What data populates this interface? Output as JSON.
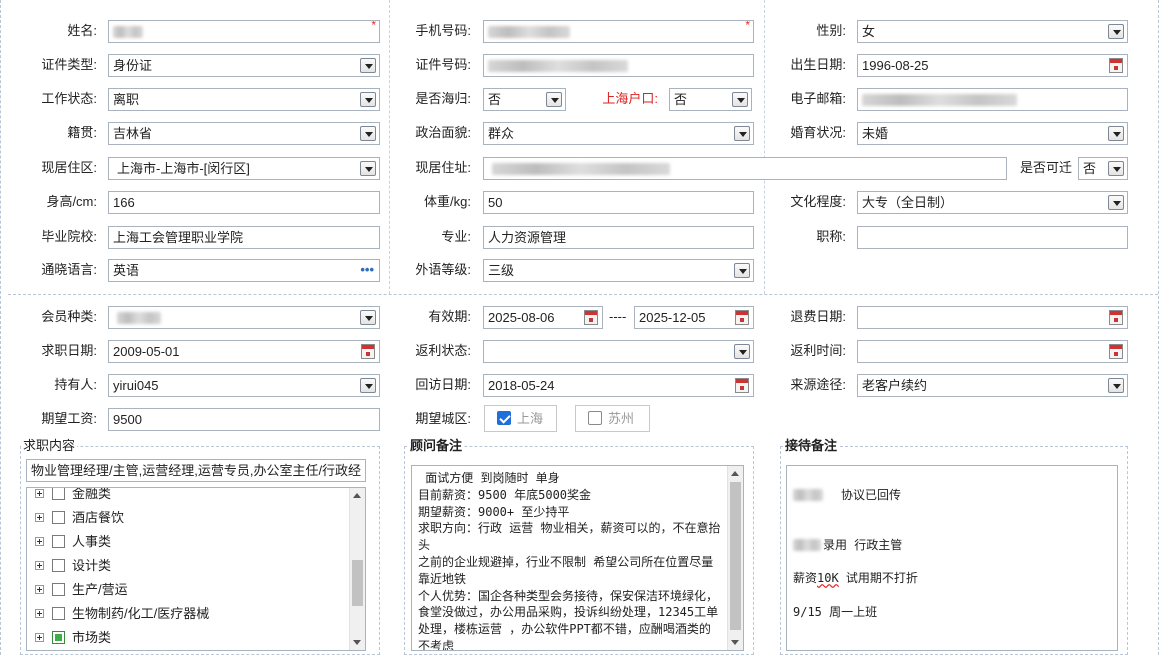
{
  "personal": {
    "name": {
      "label": "姓名:"
    },
    "phone": {
      "label": "手机号码:"
    },
    "gender": {
      "label": "性别:",
      "value": "女"
    },
    "id_type": {
      "label": "证件类型:",
      "value": "身份证"
    },
    "id_no": {
      "label": "证件号码:"
    },
    "birth": {
      "label": "出生日期:",
      "value": "1996-08-25"
    },
    "work_status": {
      "label": "工作状态:",
      "value": "离职"
    },
    "returnee": {
      "label": "是否海归:",
      "value": "否"
    },
    "sh_hukou": {
      "label": "上海户口:",
      "value": "否"
    },
    "email": {
      "label": "电子邮箱:"
    },
    "native": {
      "label": "籍贯:",
      "value": "吉林省"
    },
    "political": {
      "label": "政治面貌:",
      "value": "群众"
    },
    "marital": {
      "label": "婚育状况:",
      "value": "未婚"
    },
    "district": {
      "label": "现居住区:",
      "value": "上海市-上海市-[闵行区]"
    },
    "address": {
      "label": "现居住址:"
    },
    "relocate": {
      "label": "是否可迁",
      "value": "否"
    },
    "height": {
      "label": "身高/cm:",
      "value": "166"
    },
    "weight": {
      "label": "体重/kg:",
      "value": "50"
    },
    "education": {
      "label": "文化程度:",
      "value": "大专（全日制）"
    },
    "school": {
      "label": "毕业院校:",
      "value": "上海工会管理职业学院"
    },
    "major": {
      "label": "专业:",
      "value": "人力资源管理"
    },
    "title": {
      "label": "职称:",
      "value": ""
    },
    "language": {
      "label": "通晓语言:",
      "value": "英语",
      "more": "•••"
    },
    "lang_level": {
      "label": "外语等级:",
      "value": "三级"
    }
  },
  "membership": {
    "member_type": {
      "label": "会员种类:"
    },
    "valid": {
      "label": "有效期:",
      "from": "2025-08-06",
      "sep": "----",
      "to": "2025-12-05"
    },
    "refund_date": {
      "label": "退费日期:",
      "value": ""
    },
    "job_date": {
      "label": "求职日期:",
      "value": "2009-05-01"
    },
    "rebate_status": {
      "label": "返利状态:",
      "value": ""
    },
    "rebate_time": {
      "label": "返利时间:",
      "value": ""
    },
    "holder": {
      "label": "持有人:",
      "value": "yirui045"
    },
    "visit_date": {
      "label": "回访日期:",
      "value": "2018-05-24"
    },
    "source": {
      "label": "来源途径:",
      "value": "老客户续约"
    },
    "salary": {
      "label": "期望工资:",
      "value": "9500"
    },
    "city": {
      "label": "期望城区:",
      "options": [
        {
          "label": "上海",
          "checked": true
        },
        {
          "label": "苏州",
          "checked": false
        }
      ]
    }
  },
  "job_panel": {
    "title": "求职内容",
    "summary": "物业管理经理/主管,运营经理,运营专员,办公室主任/行政经",
    "tree": [
      {
        "label": "金融类",
        "checked": false
      },
      {
        "label": "酒店餐饮",
        "checked": false
      },
      {
        "label": "人事类",
        "checked": false
      },
      {
        "label": "设计类",
        "checked": false
      },
      {
        "label": "生产/营运",
        "checked": false
      },
      {
        "label": "生物制药/化工/医疗器械",
        "checked": false
      },
      {
        "label": "市场类",
        "checked": true
      }
    ]
  },
  "consultant_panel": {
    "title": "顾问备注",
    "lines": [
      " 面试方便 到岗随时 单身",
      "目前薪资：9500 年底5000奖金",
      "期望薪资：9000+ 至少持平",
      "求职方向：行政 运营 物业相关，薪资可以的，不在意抬头",
      "之前的企业规避掉，行业不限制 希望公司所在位置尽量靠近地铁",
      "个人优势：国企各种类型会务接待，保安保洁环境绿化，食堂没做过，办公用品采购，投诉纠纷处理，12345工单处理，楼栋运营 ，办公软件PPT都不错，应酬喝酒类的不考虑"
    ]
  },
  "reception_panel": {
    "title": "接待备注",
    "line1": "协议已回传",
    "line2": "录用 行政主管",
    "line3a": "薪资",
    "line3b": "10K",
    "line3c": " 试用期不打折",
    "line4": "9/15 周一上班"
  }
}
